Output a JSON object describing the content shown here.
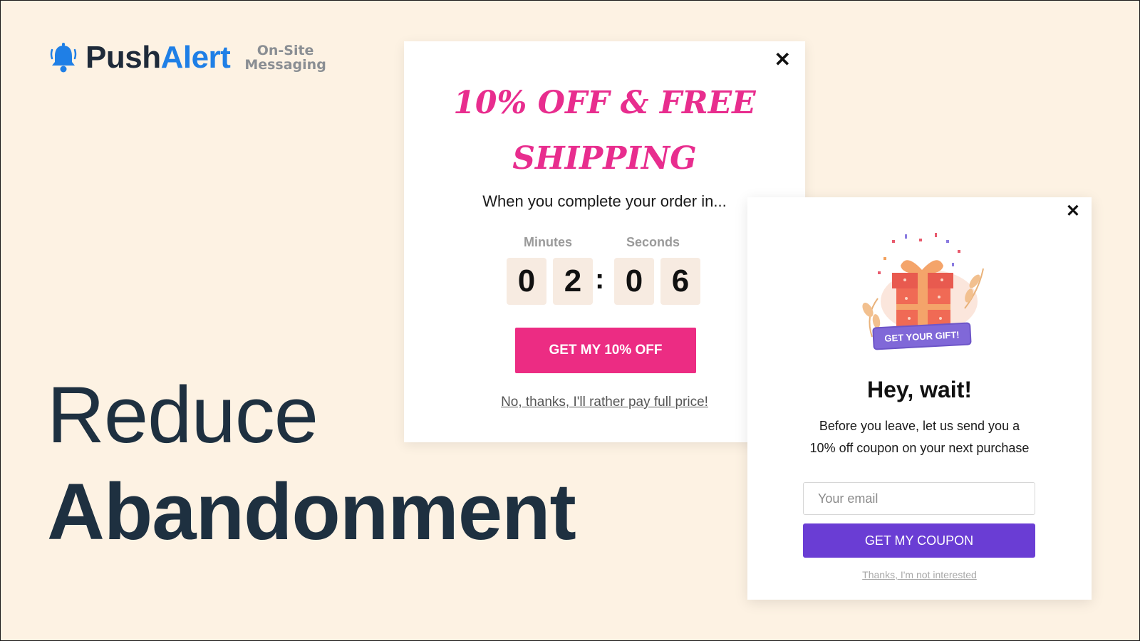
{
  "brand": {
    "name_part1": "Push",
    "name_part2": "Alert",
    "tagline_line1": "On-Site",
    "tagline_line2": "Messaging",
    "accent_color": "#1f7fe6",
    "icon": "bell-icon"
  },
  "headline": {
    "line1": "Reduce",
    "line2": "Abandonment"
  },
  "popup_countdown": {
    "close_label": "✕",
    "title_line1": "10% OFF & FREE",
    "title_line2": "SHIPPING",
    "subtitle": "When you complete your order in...",
    "minutes_label": "Minutes",
    "seconds_label": "Seconds",
    "digits": [
      "0",
      "2",
      "0",
      "6"
    ],
    "separator": ":",
    "cta_label": "GET MY 10% OFF",
    "decline_label": "No, thanks, I'll rather pay full price!",
    "accent_color": "#ec2c83"
  },
  "popup_exit": {
    "close_label": "✕",
    "gift_badge": "GET YOUR GIFT!",
    "title": "Hey, wait!",
    "body_line1": "Before you leave, let us send you a",
    "body_line2": "10% off coupon on your next purchase",
    "email_placeholder": "Your email",
    "cta_label": "GET MY COUPON",
    "decline_label": "Thanks, I'm not interested",
    "accent_color": "#6a3dd4"
  }
}
